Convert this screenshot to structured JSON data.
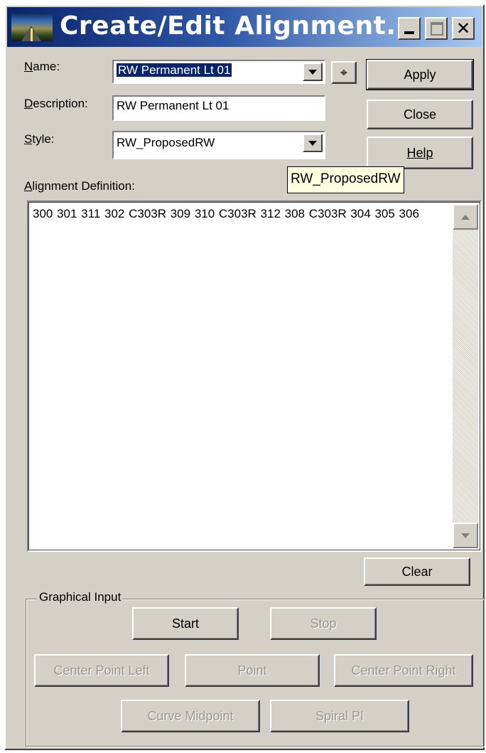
{
  "window": {
    "title": "Create/Edit Alignment..."
  },
  "form": {
    "name_label_key": "N",
    "name_label_rest": "ame:",
    "name_value": "RW Permanent Lt 01",
    "description_label_key": "D",
    "description_label_rest": "escription:",
    "description_value": "RW Permanent Lt 01",
    "style_label_key": "S",
    "style_label_rest": "tyle:",
    "style_value": "RW_ProposedRW",
    "alignment_label_key": "A",
    "alignment_label_rest": "lignment Definition:",
    "alignment_text": "300 301 311 302  C303R 309 310  C303R 312 308  C303R 304 305 306"
  },
  "tooltip": {
    "text": "RW_ProposedRW"
  },
  "buttons": {
    "apply": "Apply",
    "close": "Close",
    "help": "Help",
    "clear": "Clear"
  },
  "graphical_input": {
    "legend": "Graphical Input",
    "start": "Start",
    "stop": "Stop",
    "center_point_left": "Center Point Left",
    "point": "Point",
    "center_point_right": "Center Point Right",
    "curve_midpoint": "Curve Midpoint",
    "spiral_pi": "Spiral PI"
  },
  "icons": {
    "app": "road-alignment-icon",
    "pick": "target-crosshair-icon",
    "dropdown": "chevron-down-icon",
    "scroll_up": "arrow-up-icon",
    "scroll_down": "arrow-down-icon"
  }
}
